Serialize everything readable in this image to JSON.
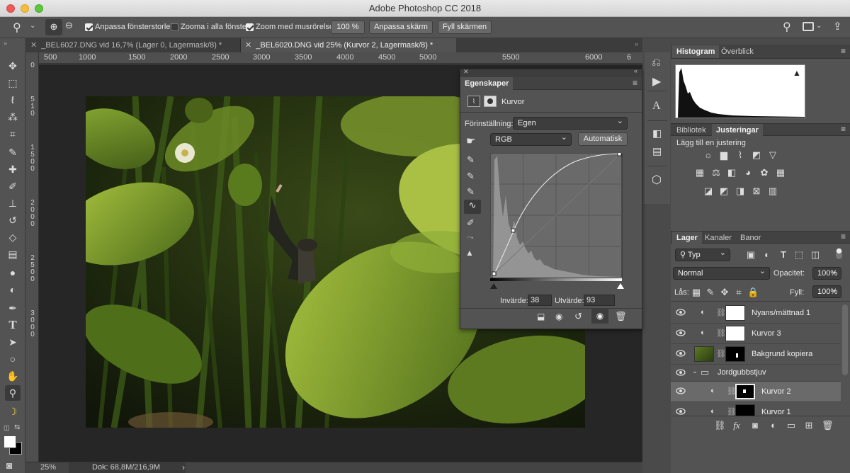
{
  "window": {
    "title": "Adobe Photoshop CC 2018"
  },
  "options": {
    "cb_resize": "Anpassa fönsterstorlek",
    "cb_zoom_all": "Zooma i alla fönster",
    "cb_scrubby": "Zoom med musrörelse",
    "zoom_value": "100 %",
    "fit_screen": "Anpassa skärm",
    "fill_screen": "Fyll skärmen"
  },
  "tabs": [
    {
      "label": "_BEL6027.DNG vid 16,7% (Lager 0, Lagermask/8) *"
    },
    {
      "label": "_BEL6020.DNG vid 25% (Kurvor 2, Lagermask/8) *"
    }
  ],
  "ruler": {
    "top": [
      "500",
      "1000",
      "1500",
      "2000",
      "2500",
      "3000",
      "3500",
      "4000",
      "4500",
      "5000",
      "5500",
      "6000",
      "6"
    ],
    "left": [
      "0",
      "5",
      "1",
      "0",
      "0",
      "1",
      "5",
      "0",
      "0",
      "2",
      "0",
      "0",
      "0",
      "2",
      "5",
      "0",
      "0",
      "3",
      "0",
      "0",
      "0"
    ]
  },
  "status": {
    "zoom": "25%",
    "doc": "Dok: 68,8M/216,9M"
  },
  "properties": {
    "panel_title": "Egenskaper",
    "adjustment_name": "Kurvor",
    "preset_label": "Förinställning:",
    "preset_value": "Egen",
    "channel": "RGB",
    "auto_button": "Automatisk",
    "input_label": "Invärde:",
    "input_value": "38",
    "output_label": "Utvärde:",
    "output_value": "93"
  },
  "histogram_panel": {
    "tabs": [
      "Histogram",
      "Överblick"
    ]
  },
  "adjustments_panel": {
    "tabs": [
      "Bibliotek",
      "Justeringar"
    ],
    "add_label": "Lägg till en justering"
  },
  "layers_panel": {
    "tabs": [
      "Lager",
      "Kanaler",
      "Banor"
    ],
    "filter": "Typ",
    "blend_mode": "Normal",
    "opacity_label": "Opacitet:",
    "opacity_value": "100%",
    "lock_label": "Lås:",
    "fill_label": "Fyll:",
    "fill_value": "100%",
    "layers": [
      {
        "name": "Nyans/mättnad 1"
      },
      {
        "name": "Kurvor 3"
      },
      {
        "name": "Bakgrund kopiera"
      },
      {
        "name": "Jordgubbstjuv"
      },
      {
        "name": "Kurvor 2"
      },
      {
        "name": "Kurvor 1"
      }
    ]
  },
  "colors": {
    "accent": "#3c3c3c",
    "panel": "#535353",
    "canvas": "#262626"
  },
  "icons": [
    "zoom-icon",
    "zoom-in-icon",
    "zoom-out-icon",
    "search-icon",
    "workspace-icon",
    "share-icon",
    "move-tool-icon",
    "marquee-icon",
    "lasso-icon",
    "magic-wand-icon",
    "crop-icon",
    "eyedropper-icon",
    "healing-icon",
    "brush-icon",
    "stamp-icon",
    "history-brush-icon",
    "eraser-icon",
    "gradient-icon",
    "blur-icon",
    "dodge-icon",
    "pen-icon",
    "type-icon",
    "path-select-icon",
    "shape-icon",
    "hand-icon",
    "banana-icon",
    "eye-icon",
    "folder-icon",
    "link-icon",
    "trash-icon"
  ]
}
